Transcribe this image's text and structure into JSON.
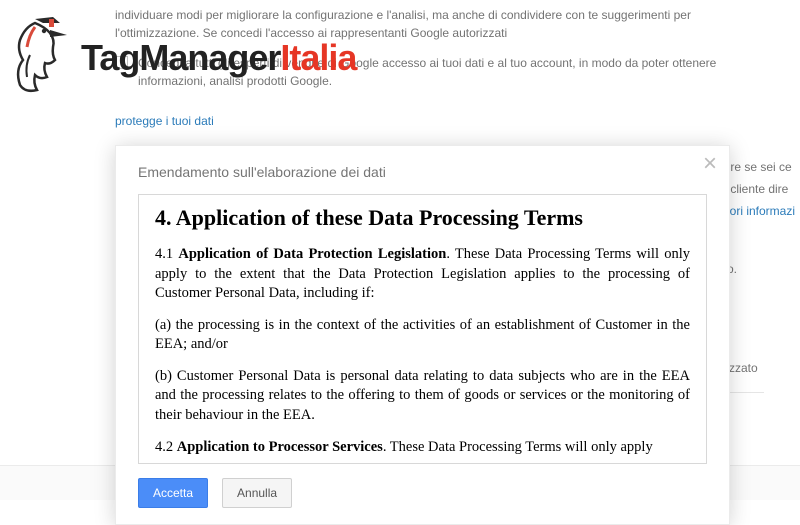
{
  "logo": {
    "text_prefix": "TagManager",
    "text_suffix": "Italia"
  },
  "background": {
    "truncated_top": "individuare modi per migliorare la configurazione e l'analisi, ma anche di condividere con te suggerimenti per l'ottimizzazione. Se concedi l'accesso ai rappresentanti Google autorizzati",
    "checkbox2_label": "Concedi a tutti gli esperti di vendite di Google accesso ai tuoi dati e al tuo account, in modo da poter ottenere informazioni, analisi prodotti Google.",
    "protect_link": "protegge i tuoi dati",
    "section_title": "Emendamento sull'elaborazione dei dati"
  },
  "right": {
    "frag1": "oppure se sei ce",
    "frag2": "ome cliente dire",
    "frag3_link": "ulteriori informazi",
    "accepted": "ettato.",
    "indirizzato": "indirizzato"
  },
  "modal": {
    "title": "Emendamento sull'elaborazione dei dati",
    "heading": "4. Application of these Data Processing Terms",
    "p41_lead": "4.1 ",
    "p41_bold": "Application of Data Protection Legislation",
    "p41_rest": ". These Data Processing Terms will only apply to the extent that the Data Protection Legislation applies to the processing of Customer Personal Data, including if:",
    "p_a": "(a) the processing is in the context of the activities of an establishment of Customer in the EEA; and/or",
    "p_b": "(b) Customer Personal Data is personal data relating to data subjects who are in the EEA and the processing relates to the offering to them of goods or services or the monitoring of their behaviour in the EEA.",
    "p42_lead": "4.2 ",
    "p42_bold": "Application to Processor Services",
    "p42_rest": ". These Data Processing Terms will only apply",
    "accept": "Accetta",
    "cancel": "Annulla"
  }
}
